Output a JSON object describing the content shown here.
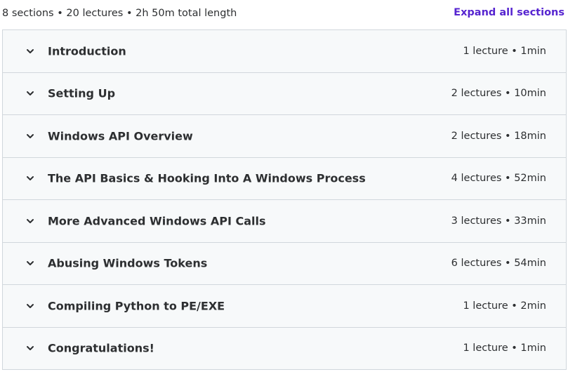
{
  "summary": {
    "text": "8 sections • 20 lectures • 2h 50m total length",
    "expand_label": "Expand all sections"
  },
  "sections": [
    {
      "title": "Introduction",
      "meta": "1 lecture • 1min"
    },
    {
      "title": "Setting Up",
      "meta": "2 lectures • 10min"
    },
    {
      "title": "Windows API Overview",
      "meta": "2 lectures • 18min"
    },
    {
      "title": "The API Basics & Hooking Into A Windows Process",
      "meta": "4 lectures • 52min"
    },
    {
      "title": "More Advanced Windows API Calls",
      "meta": "3 lectures • 33min"
    },
    {
      "title": "Abusing Windows Tokens",
      "meta": "6 lectures • 54min"
    },
    {
      "title": "Compiling Python to PE/EXE",
      "meta": "1 lecture • 2min"
    },
    {
      "title": "Congratulations!",
      "meta": "1 lecture • 1min"
    }
  ],
  "icons": {
    "section_toggle": "chevron-down-icon"
  },
  "colors": {
    "accent": "#5624d0",
    "text": "#2d2f31",
    "row_background": "#f7f9fa",
    "border": "#d1d7dc"
  }
}
